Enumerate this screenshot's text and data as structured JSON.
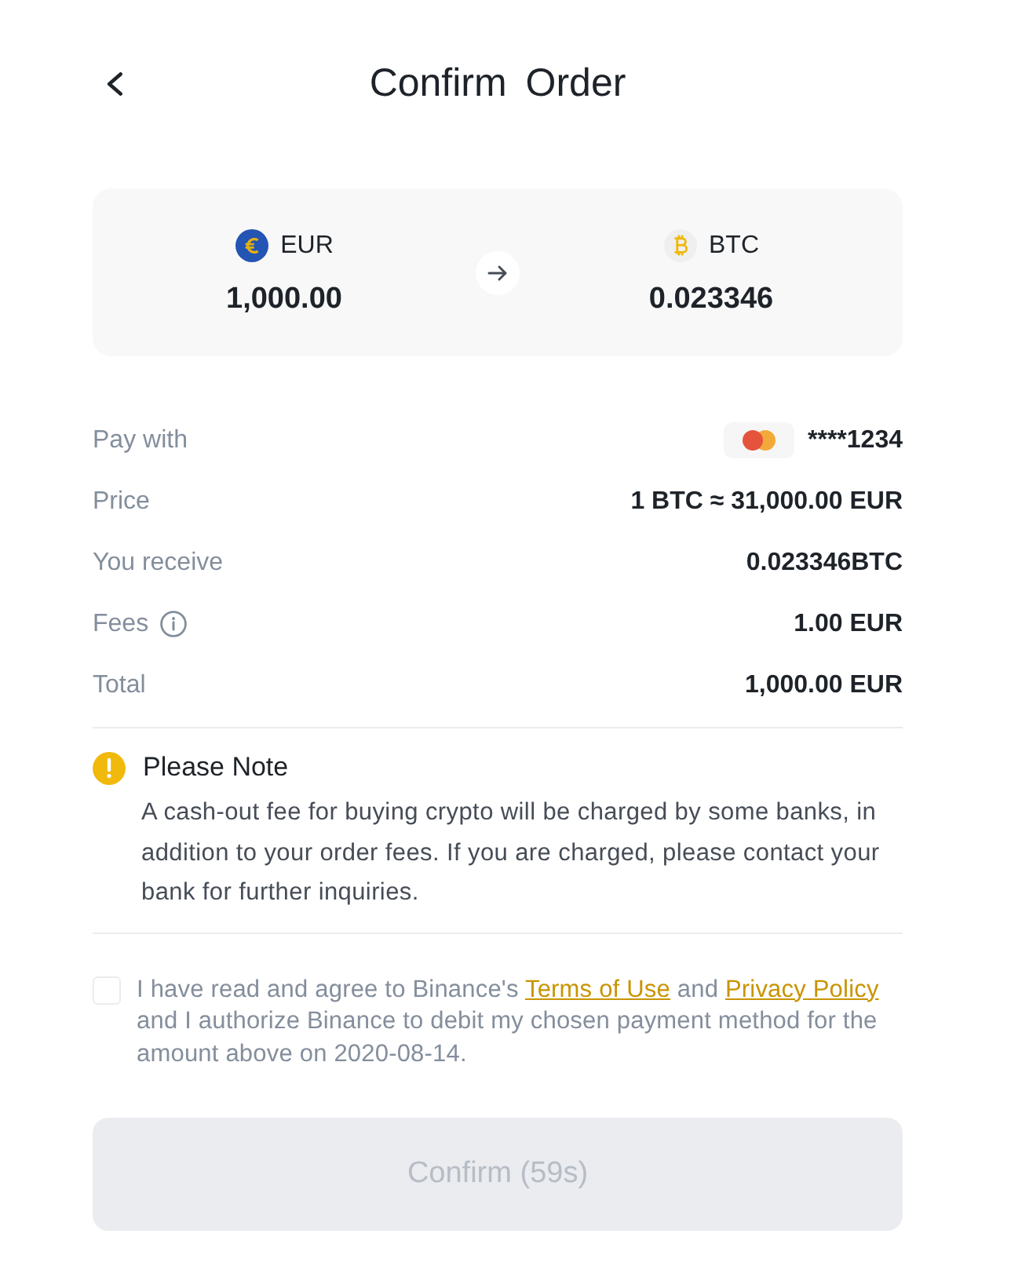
{
  "header": {
    "title": "Confirm Order"
  },
  "conversion": {
    "from": {
      "kind": "euro",
      "currency": "EUR",
      "amount": "1,000.00"
    },
    "to": {
      "kind": "bitcoin",
      "currency": "BTC",
      "amount": "0.023346"
    }
  },
  "details": [
    {
      "kind": "card",
      "label": "Pay with",
      "value": "****1234"
    },
    {
      "kind": "plain",
      "label": "Price",
      "value": "1 BTC ≈ 31,000.00 EUR"
    },
    {
      "kind": "plain",
      "label": "You receive",
      "value": "0.023346BTC"
    },
    {
      "kind": "info",
      "label": "Fees",
      "value": "1.00 EUR"
    },
    {
      "kind": "plain",
      "label": "Total",
      "value": "1,000.00 EUR"
    }
  ],
  "note": {
    "title": "Please Note",
    "text": "A cash-out fee for buying crypto will be charged by some banks, in addition to your order fees. If you are charged, please contact your bank for further inquiries."
  },
  "agreement": {
    "checked": false,
    "parts": [
      {
        "kind": "text",
        "text": "I have read and agree to Binance's "
      },
      {
        "kind": "link",
        "text": "Terms of Use"
      },
      {
        "kind": "text",
        "text": " and "
      },
      {
        "kind": "link",
        "text": "Privacy Policy"
      },
      {
        "kind": "text",
        "text": " and I authorize Binance to debit my chosen payment method for the amount above on 2020-08-14."
      }
    ]
  },
  "confirm_button": {
    "label": "Confirm (59s)",
    "disabled": true
  }
}
